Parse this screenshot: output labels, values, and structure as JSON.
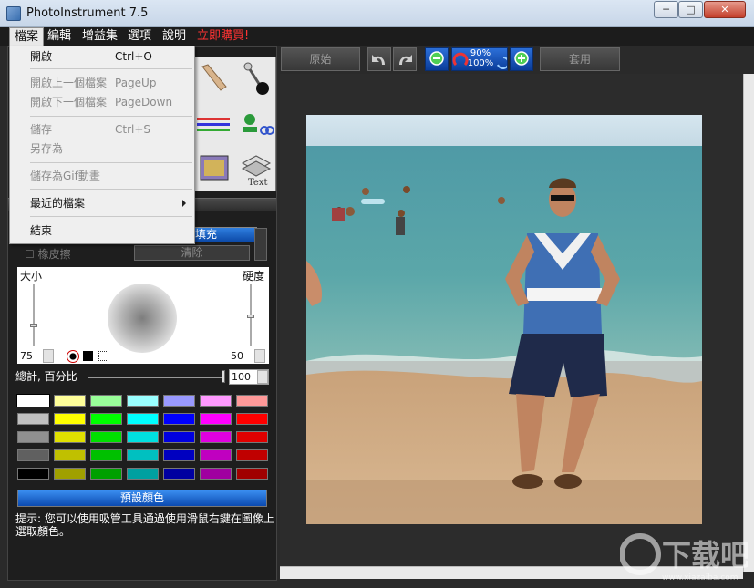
{
  "window": {
    "title": "PhotoInstrument 7.5",
    "minimize_glyph": "─",
    "maximize_glyph": "□",
    "close_glyph": "✕"
  },
  "menubar": {
    "items": [
      "檔案",
      "編輯",
      "增益集",
      "選項",
      "說明",
      "立即購買!"
    ],
    "buy_color": "#ff3333"
  },
  "file_menu": {
    "items": [
      {
        "label": "開啟",
        "shortcut": "Ctrl+O",
        "enabled": true
      },
      {
        "label": "開啟上一個檔案",
        "shortcut": "PageUp",
        "enabled": false
      },
      {
        "label": "開啟下一個檔案",
        "shortcut": "PageDown",
        "enabled": false
      },
      {
        "label": "儲存",
        "shortcut": "Ctrl+S",
        "enabled": false
      },
      {
        "label": "另存為",
        "shortcut": "",
        "enabled": false
      },
      {
        "label": "儲存為Gif動畫",
        "shortcut": "",
        "enabled": false
      },
      {
        "label": "最近的檔案",
        "shortcut": "",
        "enabled": true,
        "submenu": true
      },
      {
        "label": "結束",
        "shortcut": "",
        "enabled": true
      }
    ]
  },
  "toolbar": {
    "original_label": "原始",
    "zoom_top": "90%",
    "zoom_bottom": "100%",
    "apply_label": "套用"
  },
  "left_panel": {
    "fill_label": "填充",
    "eraser_label": "橡皮擦",
    "clear_label": "清除",
    "size_label": "大小",
    "hardness_label": "硬度",
    "size_value": "75",
    "hardness_value": "50",
    "total_label": "總計, 百分比",
    "total_value": "100",
    "preset_colors_label": "預設顏色",
    "hint": "提示: 您可以使用吸管工具通過使用滑鼠右鍵在圖像上選取顏色。"
  },
  "swatches": [
    [
      "#ffffff",
      "#ffff99",
      "#99ff99",
      "#99ffff",
      "#9999ff",
      "#ff99ff",
      "#ff9999"
    ],
    [
      "#c0c0c0",
      "#ffff00",
      "#00ff00",
      "#00ffff",
      "#0000ff",
      "#ff00ff",
      "#ff0000"
    ],
    [
      "#909090",
      "#e0e000",
      "#00e000",
      "#00e0e0",
      "#0000e0",
      "#e000e0",
      "#e00000"
    ],
    [
      "#606060",
      "#c0c000",
      "#00c000",
      "#00c0c0",
      "#0000c0",
      "#c000c0",
      "#c00000"
    ],
    [
      "#000000",
      "#a0a000",
      "#00a000",
      "#00a0a0",
      "#0000a0",
      "#a000a0",
      "#a00000"
    ]
  ],
  "watermark": {
    "text": "下载吧",
    "url": "www.xiazaiba.com"
  }
}
